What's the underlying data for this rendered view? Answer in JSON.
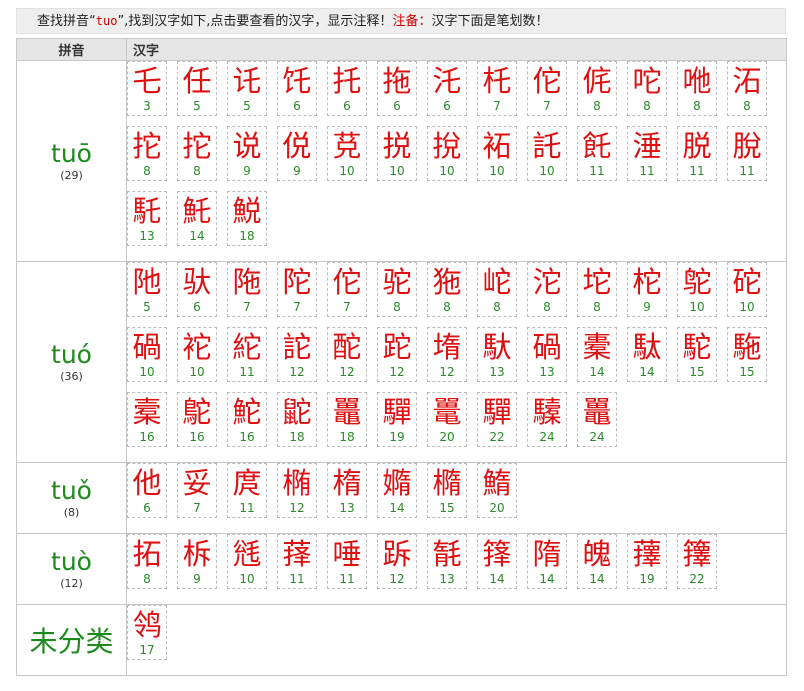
{
  "notice": {
    "prefix": "查找拼音“",
    "query": "tuo",
    "middle": "”,找到汉字如下,点击要查看的汉字，显示注释！",
    "note_label": "注备：",
    "note_text": "汉字下面是笔划数！"
  },
  "header": {
    "pinyin": "拼音",
    "hanzi": "汉字"
  },
  "groups": [
    {
      "pinyin": "tuō",
      "count": "(29)",
      "chars": [
        {
          "c": "乇",
          "s": "3"
        },
        {
          "c": "任",
          "s": "5"
        },
        {
          "c": "讬",
          "s": "5"
        },
        {
          "c": "饦",
          "s": "6"
        },
        {
          "c": "托",
          "s": "6"
        },
        {
          "c": "拖",
          "s": "6"
        },
        {
          "c": "汑",
          "s": "6"
        },
        {
          "c": "杔",
          "s": "7"
        },
        {
          "c": "佗",
          "s": "7"
        },
        {
          "c": "侂",
          "s": "8"
        },
        {
          "c": "咜",
          "s": "8"
        },
        {
          "c": "咃",
          "s": "8"
        },
        {
          "c": "沰",
          "s": "8"
        },
        {
          "c": "拕",
          "s": "8"
        },
        {
          "c": "拕",
          "s": "8"
        },
        {
          "c": "说",
          "s": "9"
        },
        {
          "c": "侻",
          "s": "9"
        },
        {
          "c": "莌",
          "s": "10"
        },
        {
          "c": "捝",
          "s": "10"
        },
        {
          "c": "挩",
          "s": "10"
        },
        {
          "c": "袥",
          "s": "10"
        },
        {
          "c": "託",
          "s": "10"
        },
        {
          "c": "飥",
          "s": "11"
        },
        {
          "c": "涶",
          "s": "11"
        },
        {
          "c": "脱",
          "s": "11"
        },
        {
          "c": "脫",
          "s": "11"
        },
        {
          "c": "馲",
          "s": "13"
        },
        {
          "c": "魠",
          "s": "14"
        },
        {
          "c": "鮵",
          "s": "18"
        }
      ]
    },
    {
      "pinyin": "tuó",
      "count": "(36)",
      "chars": [
        {
          "c": "阤",
          "s": "5"
        },
        {
          "c": "驮",
          "s": "6"
        },
        {
          "c": "陁",
          "s": "7"
        },
        {
          "c": "陀",
          "s": "7"
        },
        {
          "c": "佗",
          "s": "7"
        },
        {
          "c": "驼",
          "s": "8"
        },
        {
          "c": "狏",
          "s": "8"
        },
        {
          "c": "岮",
          "s": "8"
        },
        {
          "c": "沱",
          "s": "8"
        },
        {
          "c": "坨",
          "s": "8"
        },
        {
          "c": "柁",
          "s": "9"
        },
        {
          "c": "鸵",
          "s": "10"
        },
        {
          "c": "砣",
          "s": "10"
        },
        {
          "c": "碢",
          "s": "10"
        },
        {
          "c": "袉",
          "s": "10"
        },
        {
          "c": "紽",
          "s": "11"
        },
        {
          "c": "詑",
          "s": "12"
        },
        {
          "c": "酡",
          "s": "12"
        },
        {
          "c": "跎",
          "s": "12"
        },
        {
          "c": "堶",
          "s": "12"
        },
        {
          "c": "馱",
          "s": "13"
        },
        {
          "c": "碢",
          "s": "13"
        },
        {
          "c": "橐",
          "s": "14"
        },
        {
          "c": "駄",
          "s": "14"
        },
        {
          "c": "駝",
          "s": "15"
        },
        {
          "c": "駞",
          "s": "15"
        },
        {
          "c": "槖",
          "s": "16"
        },
        {
          "c": "鴕",
          "s": "16"
        },
        {
          "c": "鮀",
          "s": "16"
        },
        {
          "c": "鼧",
          "s": "18"
        },
        {
          "c": "鼉",
          "s": "18"
        },
        {
          "c": "驒",
          "s": "19"
        },
        {
          "c": "鼍",
          "s": "20"
        },
        {
          "c": "驒",
          "s": "22"
        },
        {
          "c": "驝",
          "s": "24"
        },
        {
          "c": "鼉",
          "s": "24"
        }
      ]
    },
    {
      "pinyin": "tuǒ",
      "count": "(8)",
      "chars": [
        {
          "c": "他",
          "s": "6"
        },
        {
          "c": "妥",
          "s": "7"
        },
        {
          "c": "庹",
          "s": "11"
        },
        {
          "c": "椭",
          "s": "12"
        },
        {
          "c": "楕",
          "s": "13"
        },
        {
          "c": "嫷",
          "s": "14"
        },
        {
          "c": "橢",
          "s": "15"
        },
        {
          "c": "鰖",
          "s": "20"
        }
      ]
    },
    {
      "pinyin": "tuò",
      "count": "(12)",
      "chars": [
        {
          "c": "拓",
          "s": "8"
        },
        {
          "c": "柝",
          "s": "9"
        },
        {
          "c": "毤",
          "s": "10"
        },
        {
          "c": "萚",
          "s": "11"
        },
        {
          "c": "唾",
          "s": "11"
        },
        {
          "c": "跅",
          "s": "12"
        },
        {
          "c": "毻",
          "s": "13"
        },
        {
          "c": "箨",
          "s": "14"
        },
        {
          "c": "隋",
          "s": "14"
        },
        {
          "c": "魄",
          "s": "14"
        },
        {
          "c": "蘀",
          "s": "19"
        },
        {
          "c": "籜",
          "s": "22"
        }
      ]
    },
    {
      "pinyin": "未分类",
      "count": "",
      "chars": [
        {
          "c": "鸰",
          "s": "17"
        }
      ]
    }
  ]
}
